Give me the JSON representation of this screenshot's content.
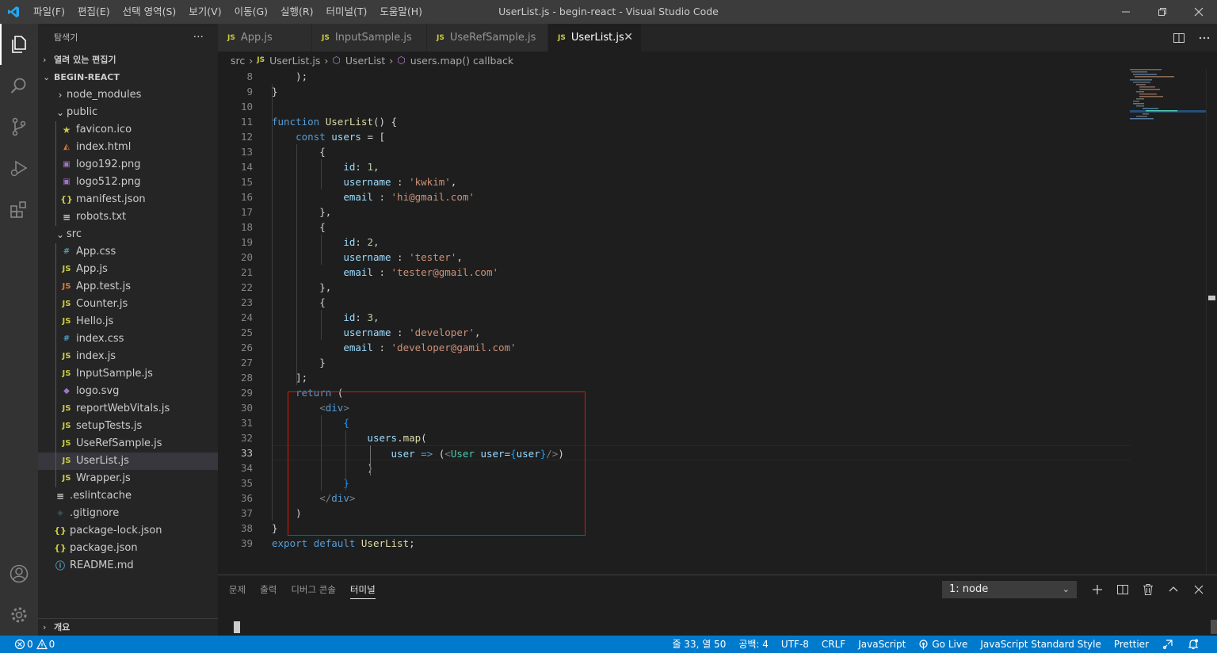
{
  "titlebar": {
    "menu": [
      "파일(F)",
      "편집(E)",
      "선택 영역(S)",
      "보기(V)",
      "이동(G)",
      "실행(R)",
      "터미널(T)",
      "도움말(H)"
    ],
    "window_title": "UserList.js - begin-react - Visual Studio Code"
  },
  "sidebar": {
    "title": "탐색기",
    "more": "···",
    "open_editors": "열려 있는 편집기",
    "project": "BEGIN-REACT",
    "items": [
      {
        "label": "node_modules",
        "icon": "chevron-right-icon"
      },
      {
        "label": "public",
        "icon": "chevron-down-icon"
      },
      {
        "label": "favicon.ico",
        "icon": "star-icon",
        "color": "#cbcb41"
      },
      {
        "label": "index.html",
        "icon": "html-icon",
        "color": "#e37933"
      },
      {
        "label": "logo192.png",
        "icon": "image-icon",
        "color": "#a074c4"
      },
      {
        "label": "logo512.png",
        "icon": "image-icon",
        "color": "#a074c4"
      },
      {
        "label": "manifest.json",
        "icon": "json-icon",
        "color": "#cbcb41"
      },
      {
        "label": "robots.txt",
        "icon": "text-file-icon",
        "color": "#cccccc"
      },
      {
        "label": "src",
        "icon": "chevron-down-icon"
      },
      {
        "label": "App.css",
        "icon": "css-icon",
        "color": "#519aba"
      },
      {
        "label": "App.js",
        "icon": "js-icon",
        "color": "#cbcb41"
      },
      {
        "label": "App.test.js",
        "icon": "js-test-icon",
        "color": "#e37933"
      },
      {
        "label": "Counter.js",
        "icon": "js-icon",
        "color": "#cbcb41"
      },
      {
        "label": "Hello.js",
        "icon": "js-icon",
        "color": "#cbcb41"
      },
      {
        "label": "index.css",
        "icon": "css-icon",
        "color": "#519aba"
      },
      {
        "label": "index.js",
        "icon": "js-icon",
        "color": "#cbcb41"
      },
      {
        "label": "InputSample.js",
        "icon": "js-icon",
        "color": "#cbcb41"
      },
      {
        "label": "logo.svg",
        "icon": "svg-icon",
        "color": "#a074c4"
      },
      {
        "label": "reportWebVitals.js",
        "icon": "js-icon",
        "color": "#cbcb41"
      },
      {
        "label": "setupTests.js",
        "icon": "js-icon",
        "color": "#cbcb41"
      },
      {
        "label": "UseRefSample.js",
        "icon": "js-icon",
        "color": "#cbcb41"
      },
      {
        "label": "UserList.js",
        "icon": "js-icon",
        "color": "#cbcb41"
      },
      {
        "label": "Wrapper.js",
        "icon": "js-icon",
        "color": "#cbcb41"
      },
      {
        "label": ".eslintcache",
        "icon": "text-file-icon",
        "color": "#cccccc"
      },
      {
        "label": ".gitignore",
        "icon": "git-icon",
        "color": "#41535b"
      },
      {
        "label": "package-lock.json",
        "icon": "json-icon",
        "color": "#cbcb41"
      },
      {
        "label": "package.json",
        "icon": "json-icon",
        "color": "#cbcb41"
      },
      {
        "label": "README.md",
        "icon": "info-icon",
        "color": "#519aba"
      }
    ],
    "outline": "개요"
  },
  "tabs": [
    {
      "label": "App.js"
    },
    {
      "label": "InputSample.js"
    },
    {
      "label": "UseRefSample.js"
    },
    {
      "label": "UserList.js"
    }
  ],
  "tab_close": "✕",
  "breadcrumbs": [
    "src",
    "UserList.js",
    "UserList",
    "users.map() callback"
  ],
  "editor": {
    "line_numbers": [
      "8",
      "9",
      "10",
      "11",
      "12",
      "13",
      "14",
      "15",
      "16",
      "17",
      "18",
      "19",
      "20",
      "21",
      "22",
      "23",
      "24",
      "25",
      "26",
      "27",
      "28",
      "29",
      "30",
      "31",
      "32",
      "33",
      "34",
      "35",
      "36",
      "37",
      "38",
      "39"
    ],
    "current_line": "33"
  },
  "panel": {
    "tabs": [
      "문제",
      "출력",
      "디버그 콘솔",
      "터미널"
    ],
    "terminal_select": "1: node"
  },
  "status": {
    "errors": "0",
    "warnings": "0",
    "position": "줄 33, 열 50",
    "indent": "공백: 4",
    "encoding": "UTF-8",
    "eol": "CRLF",
    "language": "JavaScript",
    "golive": "Go Live",
    "style": "JavaScript Standard Style",
    "prettier": "Prettier"
  },
  "colors": {
    "accent": "#007acc",
    "highlight_box": "#e51400"
  }
}
